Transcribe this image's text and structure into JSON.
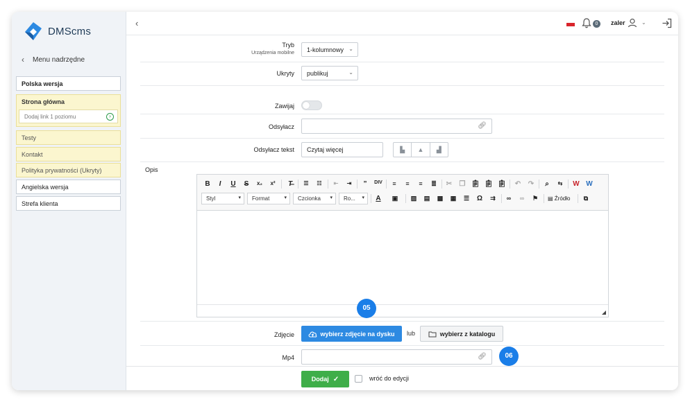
{
  "app": {
    "name": "DMScms"
  },
  "sidebar": {
    "back_label": "Menu nadrzędne",
    "items": [
      {
        "label": "Polska wersja"
      },
      {
        "label": "Strona główna",
        "add_link_placeholder": "Dodaj link 1 poziomu"
      },
      {
        "label": "Testy"
      },
      {
        "label": "Kontakt"
      },
      {
        "label": "Polityka prywatności (Ukryty)"
      },
      {
        "label": "Angielska wersja"
      },
      {
        "label": "Strefa klienta"
      }
    ]
  },
  "header": {
    "notifications_count": "0",
    "username": "zaler"
  },
  "form": {
    "tryb": {
      "label": "Tryb",
      "sublabel": "Urządzenia mobilne",
      "value": "1-kolumnowy"
    },
    "ukryty": {
      "label": "Ukryty",
      "value": "publikuj"
    },
    "zawijaj": {
      "label": "Zawijaj",
      "enabled": false
    },
    "odsylacz": {
      "label": "Odsyłacz",
      "value": ""
    },
    "odsylacz_tekst": {
      "label": "Odsyłacz tekst",
      "value": "Czytaj więcej"
    },
    "opis": {
      "label": "Opis"
    },
    "zdjecie": {
      "label": "Zdjęcie",
      "upload_button": "wybierz zdjęcie na dysku",
      "or_label": "lub",
      "catalog_button": "wybierz z katalogu"
    },
    "mp4": {
      "label": "Mp4",
      "value": ""
    }
  },
  "editor": {
    "dropdowns": [
      "Styl",
      "Format",
      "Czcionka",
      "Ro..."
    ],
    "source_label": "Źródło"
  },
  "badges": {
    "first": "05",
    "second": "06"
  },
  "footer": {
    "add_button": "Dodaj",
    "return_checkbox_label": "wróć do edycji"
  },
  "colors": {
    "primary": "#2d8ae2",
    "success": "#3fae49",
    "badge": "#1a7ee8",
    "hidden_item_bg": "#fbf6cf"
  }
}
